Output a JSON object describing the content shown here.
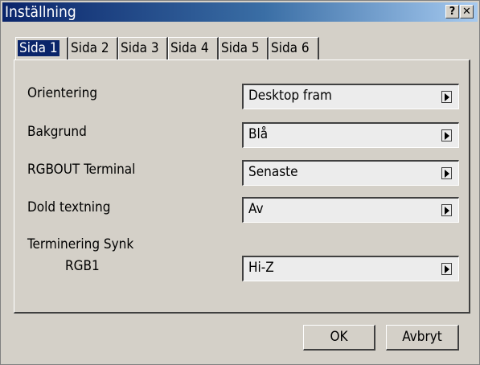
{
  "window": {
    "title": "Inställning"
  },
  "titlebar_buttons": {
    "help": "?",
    "close": "✕"
  },
  "tabs": [
    {
      "label": "Sida 1",
      "active": true
    },
    {
      "label": "Sida 2",
      "active": false
    },
    {
      "label": "Sida 3",
      "active": false
    },
    {
      "label": "Sida 4",
      "active": false
    },
    {
      "label": "Sida 5",
      "active": false
    },
    {
      "label": "Sida 6",
      "active": false
    }
  ],
  "settings": [
    {
      "label": "Orientering",
      "value": "Desktop fram"
    },
    {
      "label": "Bakgrund",
      "value": "Blå"
    },
    {
      "label": "RGBOUT Terminal",
      "value": "Senaste"
    },
    {
      "label": "Dold textning",
      "value": "Av"
    },
    {
      "label": "Terminering Synk",
      "sublabel": "RGB1",
      "value": "Hi-Z"
    }
  ],
  "buttons": {
    "ok": "OK",
    "cancel": "Avbryt"
  }
}
